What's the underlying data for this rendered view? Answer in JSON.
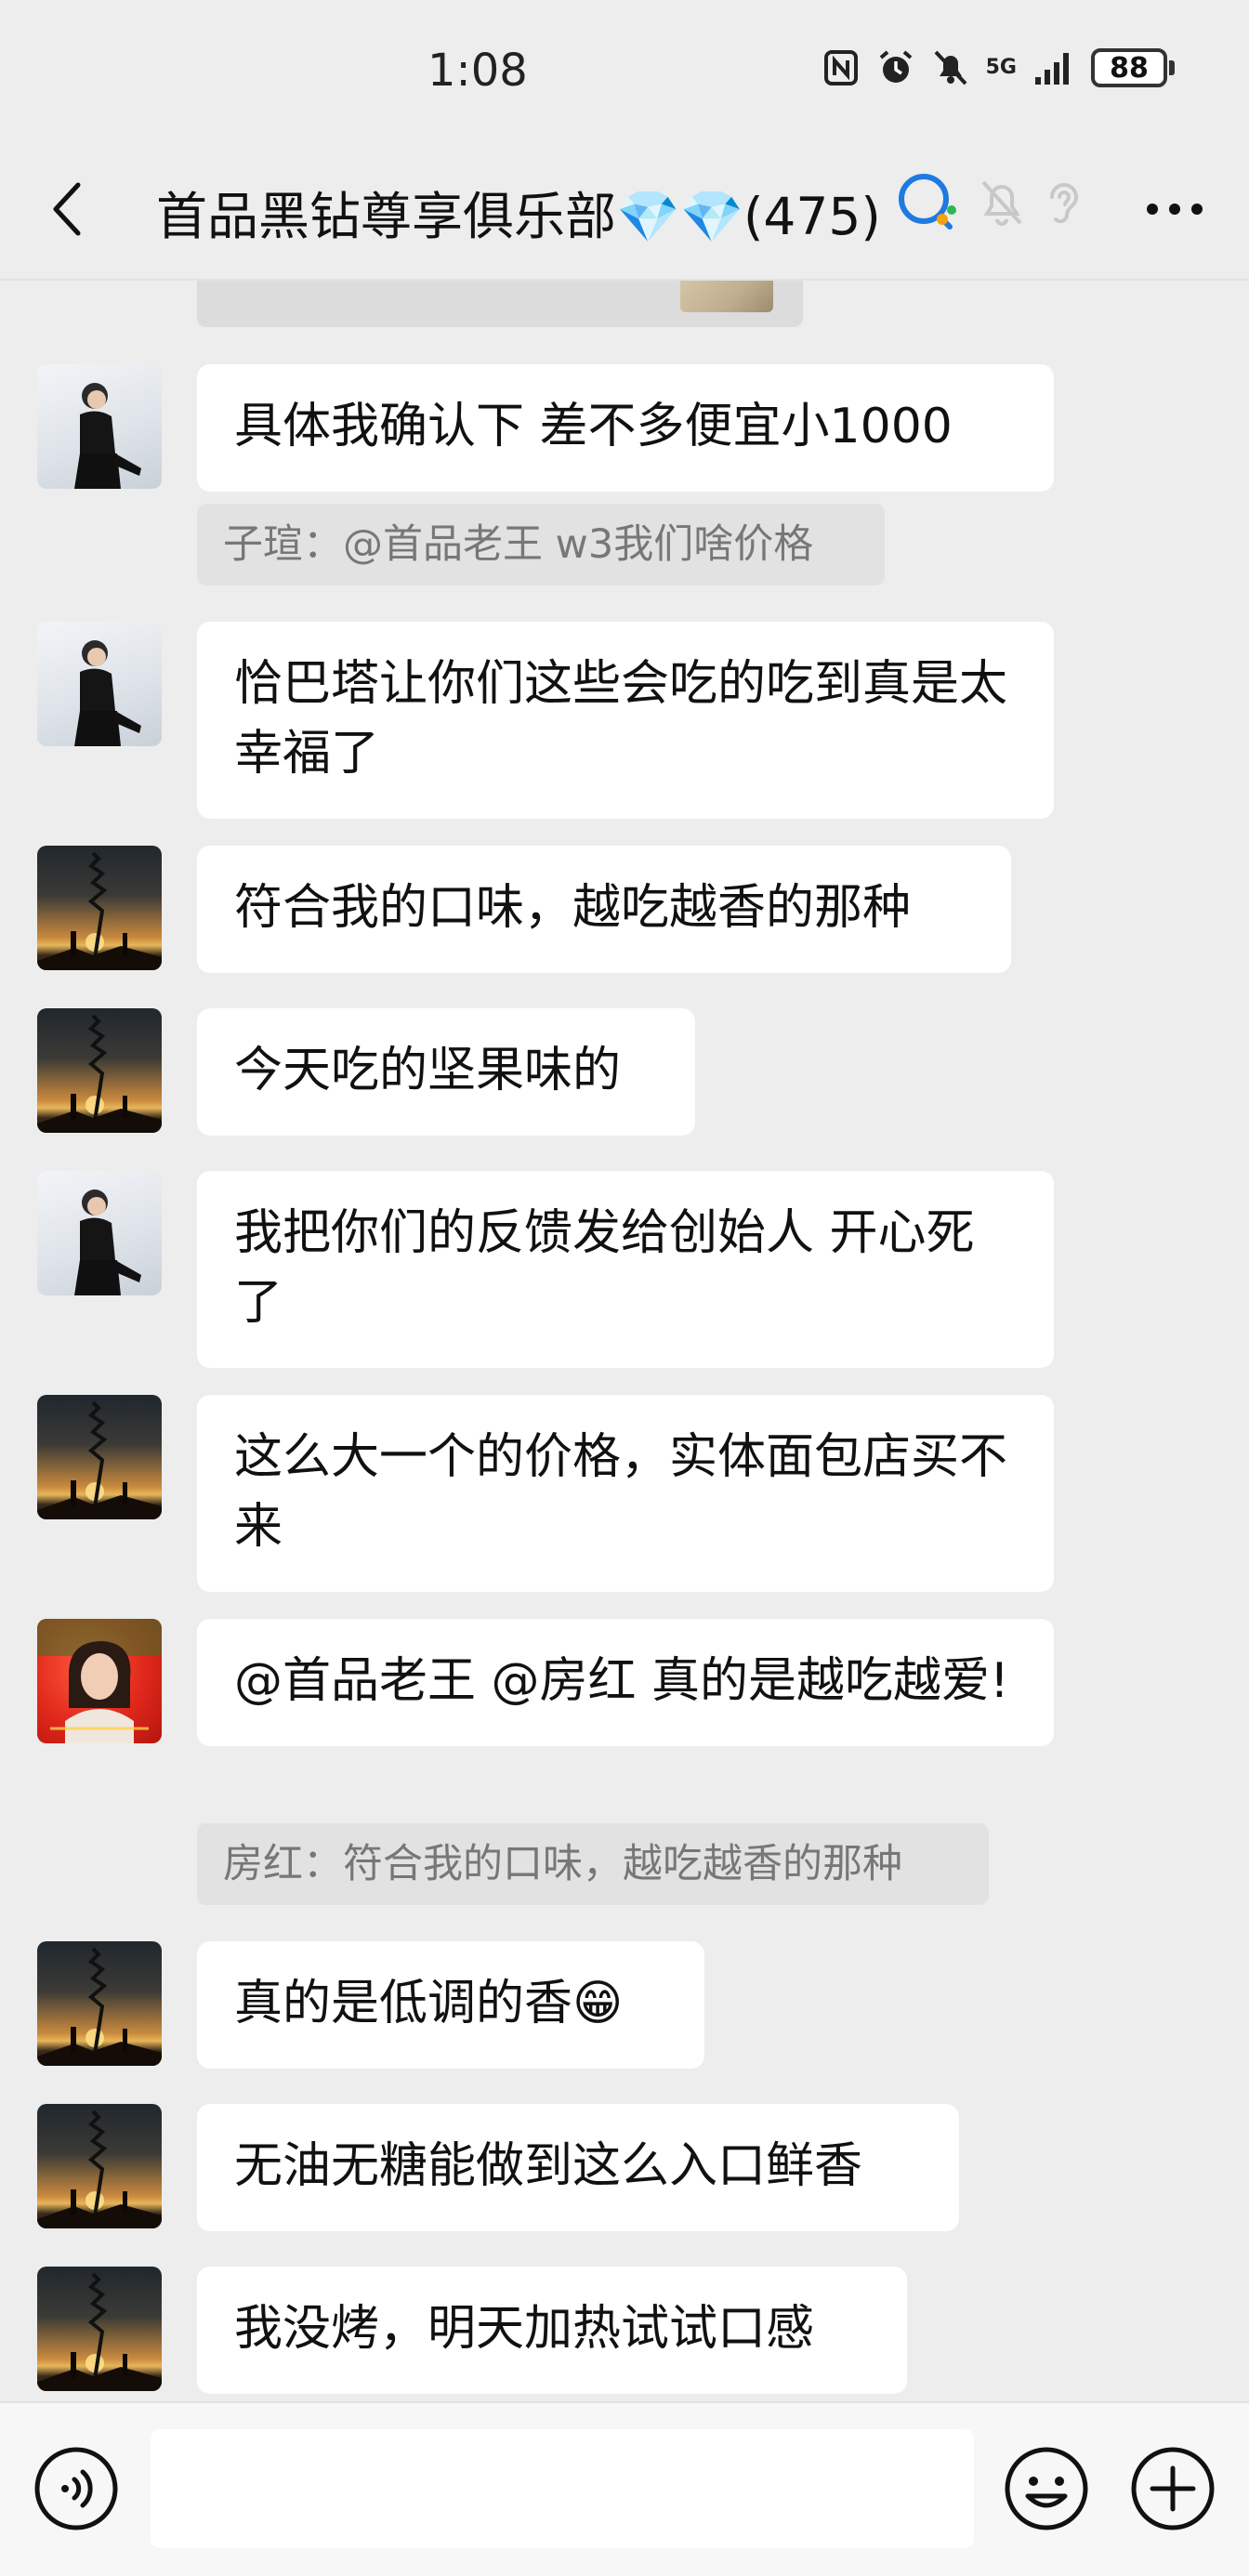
{
  "status_bar": {
    "time": "1:08",
    "network_label": "5G",
    "battery": "88"
  },
  "header": {
    "title": "首品黑钻尊享俱乐部💎💎(475)",
    "icons": [
      "back-arrow-icon",
      "chat-bubble-icon",
      "mute-bell-icon",
      "ear-icon",
      "more-icon"
    ]
  },
  "messages": [
    {
      "sender_avatar": "woman-in-black",
      "text": "具体我确认下 差不多便宜小1000",
      "quote": "子瑄：@首品老王 w3我们啥价格"
    },
    {
      "sender_avatar": "woman-in-black",
      "text": "恰巴塔让你们这些会吃的吃到真是太幸福了"
    },
    {
      "sender_avatar": "sunset-silhouette",
      "text": "符合我的口味，越吃越香的那种"
    },
    {
      "sender_avatar": "sunset-silhouette",
      "text": "今天吃的坚果味的"
    },
    {
      "sender_avatar": "woman-in-black",
      "text": "我把你们的反馈发给创始人 开心死了"
    },
    {
      "sender_avatar": "sunset-silhouette",
      "text": "这么大一个的价格，实体面包店买不来"
    },
    {
      "sender_avatar": "woman-red-background",
      "text": "@首品老王 @房红 真的是越吃越爱!",
      "quote": "房红：符合我的口味，越吃越香的那种"
    },
    {
      "sender_avatar": "sunset-silhouette",
      "text": "真的是低调的香😁"
    },
    {
      "sender_avatar": "sunset-silhouette",
      "text": "无油无糖能做到这么入口鲜香"
    },
    {
      "sender_avatar": "sunset-silhouette",
      "text": "我没烤，明天加热试试口感"
    }
  ],
  "input_bar": {
    "placeholder": "",
    "icons": [
      "voice-icon",
      "emoji-icon",
      "plus-icon"
    ]
  },
  "colors": {
    "background": "#ededed",
    "bubble": "#ffffff",
    "quote": "#e2e2e2",
    "quote_text": "#777777"
  }
}
